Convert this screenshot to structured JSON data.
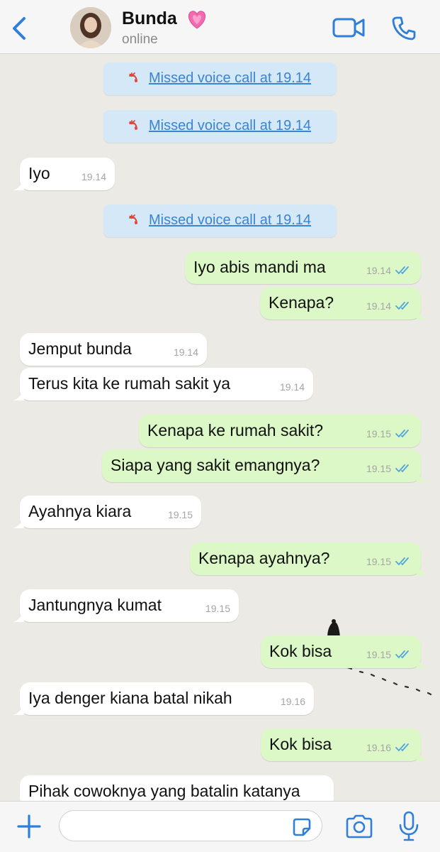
{
  "header": {
    "contact_name": "Bunda",
    "status": "online",
    "icons": [
      "back-chevron-icon",
      "avatar",
      "pink-heart-icon",
      "video-call-icon",
      "phone-icon"
    ],
    "accent_color": "#2f7fd8"
  },
  "messages": [
    {
      "type": "system",
      "text": "Missed voice call at 19.14"
    },
    {
      "type": "system",
      "text": "Missed voice call at 19.14"
    },
    {
      "type": "incoming",
      "text": "Iyo",
      "time": "19.14"
    },
    {
      "type": "system",
      "text": "Missed voice call at 19.14"
    },
    {
      "type": "outgoing",
      "text": "Iyo abis mandi ma",
      "time": "19.14"
    },
    {
      "type": "outgoing",
      "text": "Kenapa?",
      "time": "19.14"
    },
    {
      "type": "incoming",
      "text": "Jemput bunda",
      "time": "19.14"
    },
    {
      "type": "incoming",
      "text": "Terus kita ke rumah sakit ya",
      "time": "19.14"
    },
    {
      "type": "outgoing",
      "text": "Kenapa ke rumah sakit?",
      "time": "19.15"
    },
    {
      "type": "outgoing",
      "text": "Siapa yang sakit emangnya?",
      "time": "19.15"
    },
    {
      "type": "incoming",
      "text": "Ayahnya kiara",
      "time": "19.15"
    },
    {
      "type": "outgoing",
      "text": "Kenapa ayahnya?",
      "time": "19.15"
    },
    {
      "type": "incoming",
      "text": "Jantungnya kumat",
      "time": "19.15"
    },
    {
      "type": "outgoing",
      "text": "Kok bisa",
      "time": "19.15"
    },
    {
      "type": "incoming",
      "text": "Iya denger kiana batal nikah",
      "time": "19.16"
    },
    {
      "type": "outgoing",
      "text": "Kok bisa",
      "time": "19.16"
    },
    {
      "type": "incoming",
      "text": "Pihak cowoknya yang batalin katanya",
      "time": ""
    }
  ],
  "input": {
    "value": "",
    "placeholder": ""
  },
  "colors": {
    "incoming_bubble": "#ffffff",
    "outgoing_bubble": "#dcf8c6",
    "system_bubble": "#d4e8f8",
    "missed_call_red": "#e0463b",
    "read_ticks": "#4fa3e0",
    "chat_background": "#eceae5"
  }
}
